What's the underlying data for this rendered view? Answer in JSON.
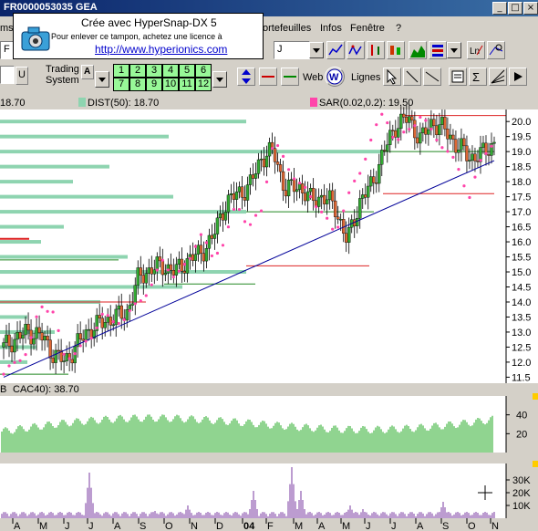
{
  "window": {
    "title": "FR0000053035  GEA"
  },
  "menu": {
    "items": [
      "ortefeuilles",
      "Infos",
      "Fenêtre",
      "?"
    ],
    "left_fragment": "ms"
  },
  "watermark": {
    "line1": "Crée avec HyperSnap-DX 5",
    "line2": "Pour enlever ce tampon, achetez une licence à",
    "line3": "http://www.hyperionics.com"
  },
  "toolbar": {
    "symbol_combo": "F",
    "period_combo": "J",
    "trading_label_1": "Trading",
    "trading_label_2": "System",
    "bold_a": "A",
    "u_btn": "U",
    "web_label": "Web",
    "lignes_label": "Lignes",
    "period_buttons": [
      "1",
      "2",
      "3",
      "4",
      "5",
      "6",
      "7",
      "8",
      "9",
      "10",
      "11",
      "12"
    ]
  },
  "legend": {
    "price_value": "18.70",
    "dist_label": "DIST(50): 18.70",
    "sar_label": "SAR(0.02,0.2): 19.50"
  },
  "indicator_label": "CAC40): 38.70",
  "indicator_prefix": "B",
  "colors": {
    "background": "#ffffff",
    "candle_up": "#33aa33",
    "candle_down": "#dd6633",
    "sar": "#ff44aa",
    "trend": "#000099",
    "volume_profile": "#8ed4b0",
    "indicator": "#22aa22",
    "volume": "#7a3aa0",
    "resistance": "#dd2222"
  },
  "chart_data": [
    {
      "type": "candlestick",
      "name": "price",
      "x": [
        "A",
        "M",
        "J",
        "J",
        "A",
        "S",
        "O",
        "N",
        "D",
        "04",
        "F",
        "M",
        "A",
        "M",
        "J",
        "J",
        "A",
        "S",
        "O",
        "N"
      ],
      "ylim": [
        11.3,
        20.4
      ],
      "yticks": [
        11.5,
        12.0,
        12.5,
        13.0,
        13.5,
        14.0,
        14.5,
        15.0,
        15.5,
        16.0,
        16.5,
        17.0,
        17.5,
        18.0,
        18.5,
        19.0,
        19.5,
        20.0
      ],
      "close_series": [
        12.5,
        12.8,
        13.0,
        12.9,
        12.3,
        12.0,
        12.6,
        13.1,
        13.3,
        13.5,
        13.6,
        14.8,
        15.1,
        15.2,
        15.0,
        15.4,
        15.6,
        16.1,
        17.2,
        17.6,
        17.8,
        18.8,
        19.0,
        17.7,
        17.9,
        17.4,
        17.5,
        17.2,
        16.0,
        17.3,
        17.9,
        19.0,
        19.9,
        20.1,
        19.4,
        20.0,
        19.7,
        19.2,
        18.8,
        18.9,
        19.3
      ],
      "sar_series": [
        11.6,
        12.0,
        12.4,
        13.9,
        13.7,
        12.1,
        12.4,
        12.7,
        13.6,
        13.3,
        13.5,
        14.0,
        14.5,
        15.4,
        14.8,
        15.3,
        16.3,
        15.5,
        16.0,
        17.3,
        16.5,
        17.0,
        19.4,
        18.6,
        18.0,
        17.5,
        17.0,
        16.2,
        17.5,
        18.2,
        19.5,
        20.3,
        19.3,
        19.7,
        20.2,
        19.6,
        19.1,
        18.5,
        17.5,
        18.8,
        19.4
      ],
      "trendline": [
        [
          0,
          11.5
        ],
        [
          40,
          18.7
        ]
      ],
      "resistance_lines": [
        14.0,
        15.2,
        17.6,
        20.2
      ],
      "support_band": 19.0
    },
    {
      "type": "bar",
      "name": "CAC40 indicator",
      "value": 38.7,
      "yticks": [
        20,
        40
      ]
    },
    {
      "type": "bar",
      "name": "volume",
      "yticks": [
        "10K",
        "20K",
        "30K"
      ]
    }
  ]
}
